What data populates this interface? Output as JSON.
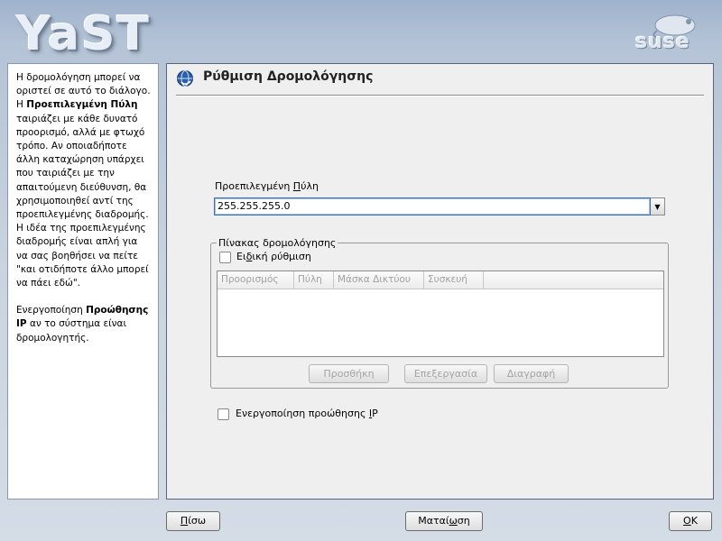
{
  "app": {
    "logo_text": "YaST",
    "brand_text": "suse"
  },
  "help": {
    "p1_a": "Η δρομολόγηση μπορεί να οριστεί σε αυτό το διάλογο. Η ",
    "p1_b": "Προεπιλεγμένη Πύλη",
    "p1_c": " ταιριάζει με κάθε δυνατό προορισμό, αλλά με φτωχό τρόπο. Αν οποιαδήποτε άλλη καταχώρηση υπάρχει που ταιριάζει με την απαιτούμενη διεύθυνση, θα χρησιμοποιηθεί αντί της προεπιλεγμένης διαδρομής. Η ιδέα της προεπιλεγμένης διαδρομής είναι απλή για να σας βοηθήσει να πείτε \"και οτιδήποτε άλλο μπορεί να πάει εδώ\".",
    "p2_a": "Ενεργοποίηση ",
    "p2_b": "Προώθησης IP",
    "p2_c": " αν το σύστημα είναι δρομολογητής."
  },
  "main": {
    "title": "Ρύθμιση Δρομολόγησης",
    "gateway": {
      "label_pre": "Προεπιλεγμένη ",
      "label_u": "Π",
      "label_post": "ύλη",
      "value": "255.255.255.0"
    },
    "routing_table": {
      "legend": "Πίνακας δρομολόγησης",
      "expert_pre": "Ει",
      "expert_u": "δ",
      "expert_post": "ική ρύθμιση",
      "columns": [
        "Προορισμός",
        "Πύλη",
        "Μάσκα Δικτύου",
        "Συσκευή"
      ],
      "buttons": {
        "add": "Προσθήκη",
        "edit": "Επεξεργασία",
        "delete": "Διαγραφή"
      }
    },
    "ip_forward": {
      "label_pre": "Ενεργοποίηση προώθησης ",
      "label_u": "I",
      "label_post": "P"
    }
  },
  "footer": {
    "back_pre": "",
    "back_u": "Π",
    "back_post": "ίσω",
    "abort_pre": "Ματαί",
    "abort_u": "ω",
    "abort_post": "ση",
    "ok_pre": "",
    "ok_u": "O",
    "ok_post": "K"
  }
}
